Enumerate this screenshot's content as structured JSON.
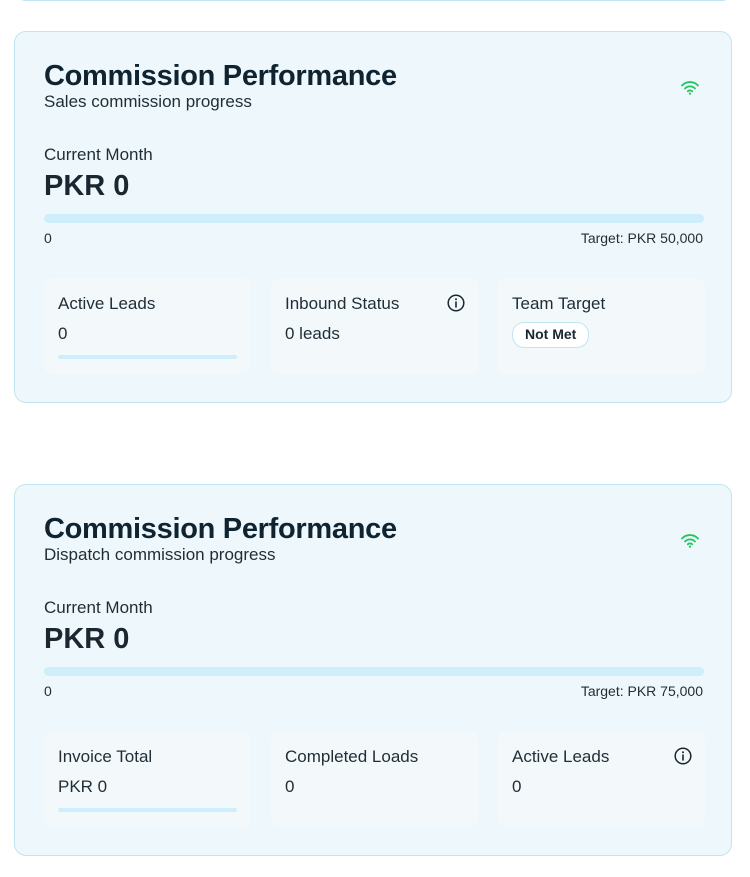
{
  "cards": [
    {
      "title": "Commission Performance",
      "subtitle": "Sales commission progress",
      "status_icon": "wifi-icon",
      "current_month_label": "Current Month",
      "current_amount": "PKR 0",
      "progress": {
        "start_label": "0",
        "target_label": "Target: PKR 50,000",
        "fraction": 0
      },
      "stats": [
        {
          "label": "Active Leads",
          "value": "0",
          "bar_fraction": 0
        },
        {
          "label": "Inbound Status",
          "value": "0 leads",
          "icon": "info-icon"
        },
        {
          "label": "Team Target",
          "badge": "Not Met"
        }
      ]
    },
    {
      "title": "Commission Performance",
      "subtitle": "Dispatch commission progress",
      "status_icon": "wifi-icon",
      "current_month_label": "Current Month",
      "current_amount": "PKR 0",
      "progress": {
        "start_label": "0",
        "target_label": "Target: PKR 75,000",
        "fraction": 0
      },
      "stats": [
        {
          "label": "Invoice Total",
          "value": "PKR 0",
          "bar_fraction": 0
        },
        {
          "label": "Completed Loads",
          "value": "0"
        },
        {
          "label": "Active Leads",
          "value": "0",
          "icon": "info-icon"
        }
      ]
    }
  ],
  "colors": {
    "card_bg": "#eef7fb",
    "card_border": "#bfe6f0",
    "track": "#cdeefa",
    "status_green": "#22c55e"
  }
}
